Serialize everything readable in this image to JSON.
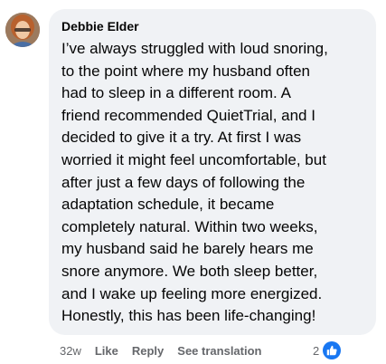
{
  "comment": {
    "author": "Debbie Elder",
    "text": "I’ve always struggled with loud snoring,\nto the point where my husband often\nhad to sleep in a different room. A\nfriend recommended QuietTrial, and I\ndecided to give it a try. At first I was\nworried it might feel uncomfortable, but\nafter just a few days of following the\nadaptation schedule, it became\ncompletely natural. Within two weeks,\nmy husband said he barely hears me\nsnore anymore. We both sleep better,\nand I wake up feeling more energized.\nHonestly, this has been life-changing!",
    "time_ago": "32w",
    "like_label": "Like",
    "reply_label": "Reply",
    "translate_label": "See translation",
    "reaction_count": "2",
    "reaction_icon": "thumbs-up-icon"
  },
  "colors": {
    "bubble": "#f0f2f5",
    "text": "#050505",
    "meta": "#65676b",
    "like_badge": "#1877f2"
  }
}
